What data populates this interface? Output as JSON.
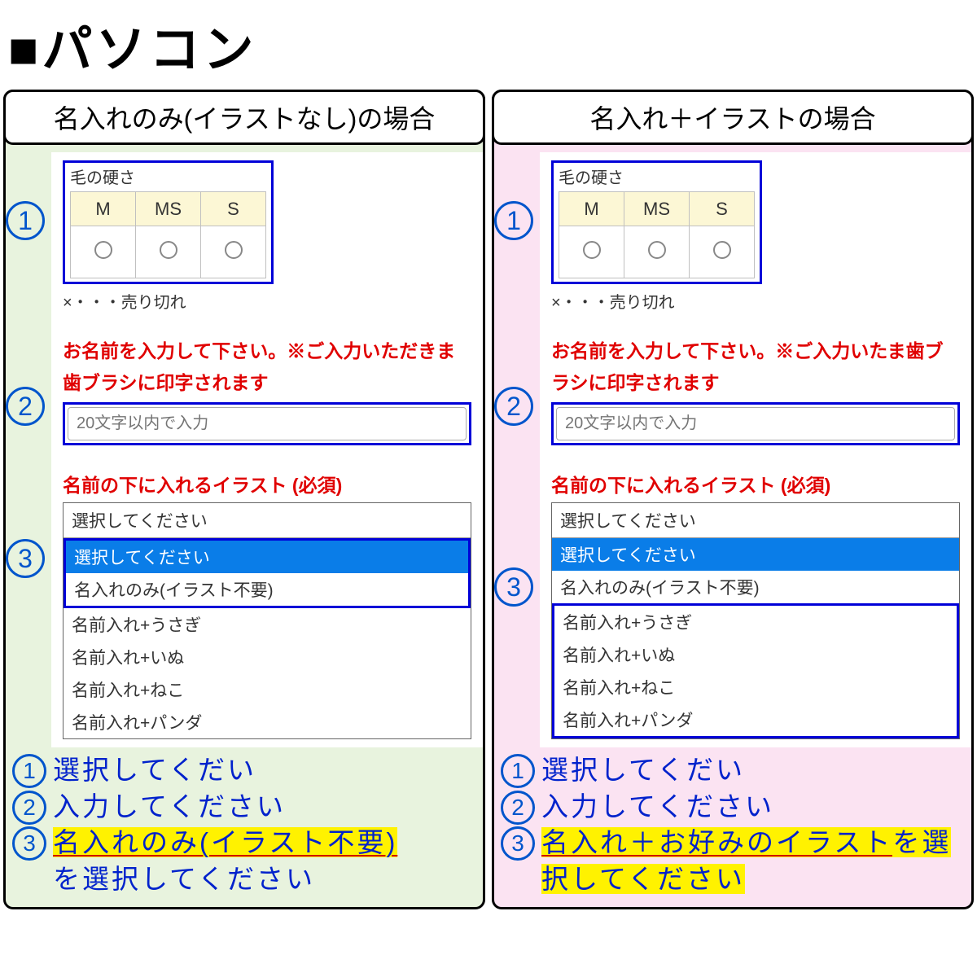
{
  "title": "■パソコン",
  "left": {
    "header": "名入れのみ(イラストなし)の場合",
    "hardness_label": "毛の硬さ",
    "hardness_cols": [
      "M",
      "MS",
      "S"
    ],
    "soldout": "×・・・売り切れ",
    "name_instruction": "お名前を入力して下さい。※ご入力いただきま歯ブラシに印字されます",
    "name_placeholder": "20文字以内で入力",
    "illust_label": "名前の下に入れるイラスト (必須)",
    "dropdown_current": "選択してください",
    "dropdown_options": [
      "選択してください",
      "名入れのみ(イラスト不要)",
      "名前入れ+うさぎ",
      "名前入れ+いぬ",
      "名前入れ+ねこ",
      "名前入れ+パンダ"
    ],
    "inst1": "選択してくだい",
    "inst2": "入力してください",
    "inst3_hl": "名入れのみ(イラスト不要)",
    "inst3_tail": "を選択してください"
  },
  "right": {
    "header": "名入れ＋イラストの場合",
    "hardness_label": "毛の硬さ",
    "hardness_cols": [
      "M",
      "MS",
      "S"
    ],
    "soldout": "×・・・売り切れ",
    "name_instruction": "お名前を入力して下さい。※ご入力いたま歯ブラシに印字されます",
    "name_placeholder": "20文字以内で入力",
    "illust_label": "名前の下に入れるイラスト (必須)",
    "dropdown_current": "選択してください",
    "dropdown_options": [
      "選択してください",
      "名入れのみ(イラスト不要)",
      "名前入れ+うさぎ",
      "名前入れ+いぬ",
      "名前入れ+ねこ",
      "名前入れ+パンダ"
    ],
    "inst1": "選択してくだい",
    "inst2": "入力してください",
    "inst3_hl": "名入れ＋お好みのイラスト",
    "inst3_tail": "を選択してください"
  }
}
